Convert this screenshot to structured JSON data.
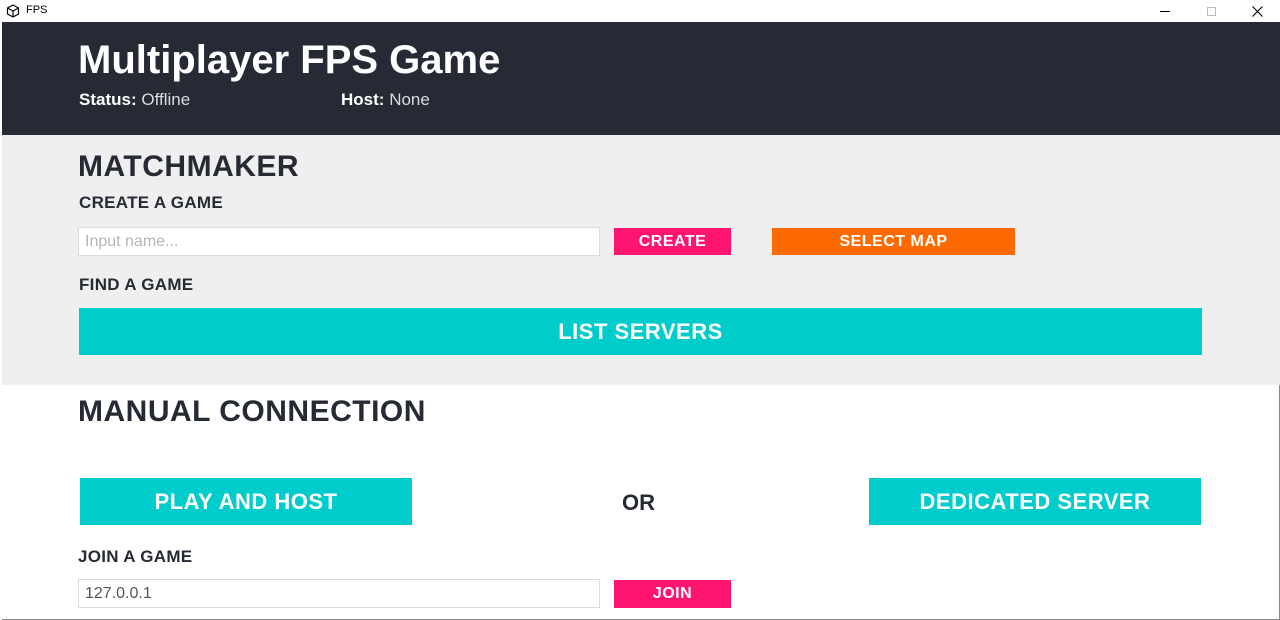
{
  "window": {
    "title": "FPS"
  },
  "header": {
    "title": "Multiplayer FPS Game",
    "status_label": "Status:",
    "status_value": "Offline",
    "host_label": "Host:",
    "host_value": "None"
  },
  "matchmaker": {
    "title": "MATCHMAKER",
    "create_title": "CREATE A GAME",
    "name_placeholder": "Input name...",
    "name_value": "",
    "create_label": "CREATE",
    "select_map_label": "SELECT MAP",
    "find_title": "FIND A GAME",
    "list_servers_label": "LIST SERVERS"
  },
  "manual": {
    "title": "MANUAL CONNECTION",
    "play_host_label": "PLAY AND HOST",
    "or_label": "OR",
    "dedicated_label": "DEDICATED SERVER",
    "join_title": "JOIN A GAME",
    "address_value": "127.0.0.1",
    "join_label": "JOIN"
  },
  "colors": {
    "header_bg": "#252a34",
    "panel_bg": "#efefef",
    "pink": "#ff1470",
    "orange": "#ff6a00",
    "cyan": "#00cccc"
  },
  "icons": {
    "app": "unity-logo-icon",
    "minimize": "minimize-icon",
    "maximize": "maximize-icon",
    "close": "close-icon"
  }
}
